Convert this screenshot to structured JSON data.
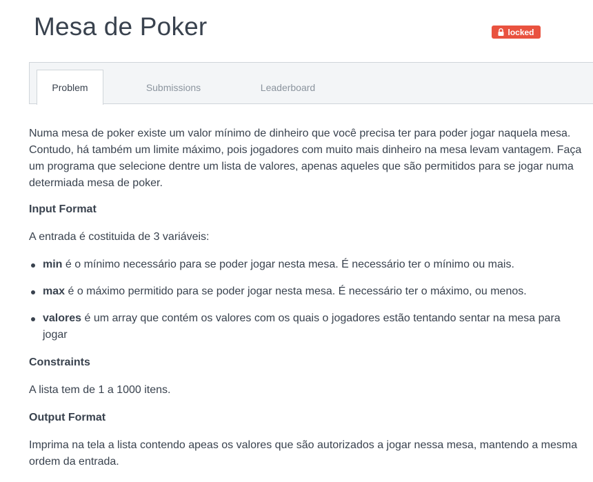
{
  "page": {
    "title": "Mesa de Poker",
    "badge": "locked"
  },
  "tabs": [
    {
      "label": "Problem",
      "active": true
    },
    {
      "label": "Submissions",
      "active": false
    },
    {
      "label": "Leaderboard",
      "active": false
    }
  ],
  "problem": {
    "statement": "Numa mesa de poker existe um valor mínimo de dinheiro que você precisa ter para poder jogar naquela mesa. Contudo, há também um limite máximo, pois jogadores com muito mais dinheiro na mesa levam vantagem. Faça um programa que selecione dentre um lista de valores, apenas aqueles que são permitidos para se jogar numa determiada mesa de poker.",
    "input_heading": "Input Format",
    "input_intro": "A entrada é costituida de 3 variáveis:",
    "variables": [
      {
        "name": "min",
        "desc": "é o mínimo necessário para se poder jogar nesta mesa. É necessário ter o mínimo ou mais."
      },
      {
        "name": "max",
        "desc": "é o máximo permitido para se poder jogar nesta mesa. É necessário ter o máximo, ou menos."
      },
      {
        "name": "valores",
        "desc": "é um array que contém os valores com os quais o jogadores estão tentando sentar na mesa para jogar"
      }
    ],
    "constraints_heading": "Constraints",
    "constraints_text": "A lista tem de 1 a 1000 itens.",
    "output_heading": "Output Format",
    "output_text": "Imprima na tela a lista contendo apeas os valores que são autorizados a jogar nessa mesa, mantendo a mesma ordem da entrada."
  },
  "colors": {
    "badge": "#e9523f",
    "text": "#39424e",
    "tab_inactive": "#8b949e",
    "tabbar_bg": "#f3f5f7"
  },
  "icons": {
    "badge_icon": "lock-icon"
  }
}
